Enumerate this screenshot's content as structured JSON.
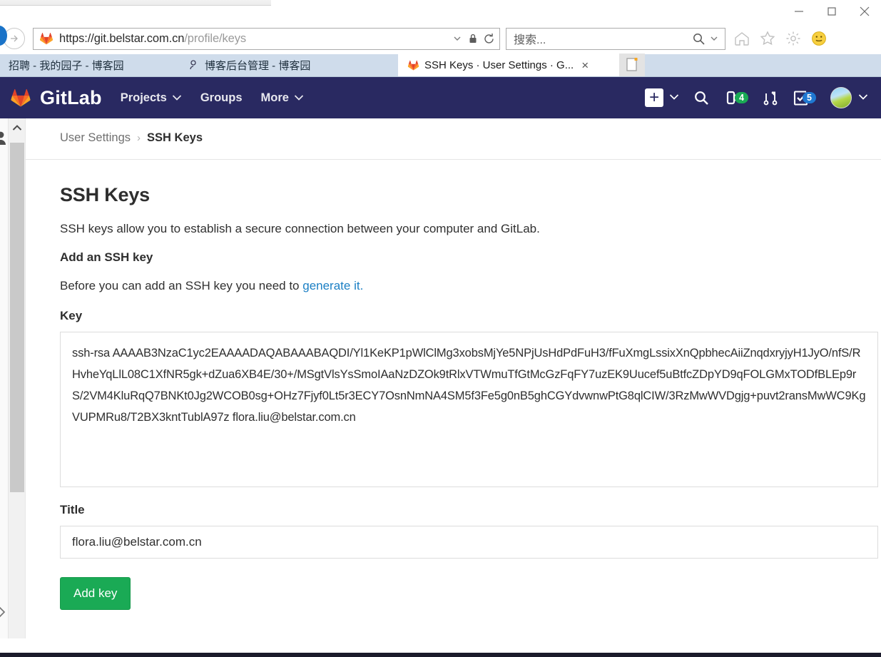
{
  "window": {
    "minimize_label": "Minimize",
    "maximize_label": "Maximize",
    "close_label": "Close"
  },
  "browser": {
    "back_icon": "back-arrow-icon",
    "url": "https://git.belstar.com.cn/profile/keys",
    "url_scheme_host": "https://git.belstar.com.cn",
    "url_path": "/profile/keys",
    "url_dropdown_icon": "chevron-down-icon",
    "lock_icon": "lock-icon",
    "reload_icon": "reload-icon",
    "search_placeholder": "搜索...",
    "search_icon": "magnifier-icon",
    "search_dropdown_icon": "chevron-down-icon",
    "toolbar_icons": [
      "home-icon",
      "star-icon",
      "gear-icon",
      "smiley-icon"
    ],
    "tabs": [
      {
        "title": "招聘 - 我的园子 - 博客园",
        "favicon": "none",
        "active": false
      },
      {
        "title": "博客后台管理 - 博客园",
        "favicon": "blog-icon",
        "active": false
      },
      {
        "title": "SSH Keys · User Settings · G...",
        "favicon": "gitlab-icon",
        "active": true,
        "close_label": "×"
      }
    ],
    "new_tab_label": "New tab"
  },
  "gitlab_nav": {
    "logo_icon": "gitlab-fox-icon",
    "wordmark": "GitLab",
    "links": [
      {
        "label": "Projects",
        "has_caret": true
      },
      {
        "label": "Groups",
        "has_caret": false
      },
      {
        "label": "More",
        "has_caret": true
      }
    ],
    "right": {
      "plus_label": "+",
      "plus_caret_icon": "chevron-down-icon",
      "search_icon": "search-icon",
      "issues_icon": "issues-icon",
      "issues_count": "4",
      "merge_requests_icon": "merge-request-icon",
      "todos_icon": "todos-check-icon",
      "todos_count": "5",
      "avatar_icon": "user-avatar",
      "avatar_caret_icon": "chevron-down-icon"
    },
    "colors": {
      "nav_bg": "#292961",
      "badge_green": "#1aaa55",
      "badge_blue": "#1f78d1"
    }
  },
  "breadcrumb": {
    "parent": "User Settings",
    "separator": "›",
    "current": "SSH Keys"
  },
  "page": {
    "title": "SSH Keys",
    "description": "SSH keys allow you to establish a secure connection between your computer and GitLab.",
    "add_key_heading": "Add an SSH key",
    "before_text": "Before you can add an SSH key you need to ",
    "generate_link": "generate it.",
    "key_label": "Key",
    "key_value": "ssh-rsa AAAAB3NzaC1yc2EAAAADAQABAAABAQDI/Yl1KeKP1pWlClMg3xobsMjYe5NPjUsHdPdFuH3/fFuXmgLssixXnQpbhecAiiZnqdxryjyH1JyO/nfS/RHvheYqLlL08C1XfNR5gk+dZua6XB4E/30+/MSgtVlsYsSmoIAaNzDZOk9tRlxVTWmuTfGtMcGzFqFY7uzEK9Uucef5uBtfcZDpYD9qFOLGMxTODfBLEp9rS/2VM4KluRqQ7BNKt0Jg2WCOB0sg+OHz7Fjyf0Lt5r3ECY7OsnNmNA4SM5f3Fe5g0nB5ghCGYdvwnwPtG8qlCIW/3RzMwWVDgjg+puvt2ransMwWC9KgVUPMRu8/T2BX3kntTublA97z flora.liu@belstar.com.cn",
    "title_label": "Title",
    "title_value": "flora.liu@belstar.com.cn",
    "submit_label": "Add key",
    "submit_color": "#1aaa55",
    "link_color": "#1b7fc4"
  }
}
